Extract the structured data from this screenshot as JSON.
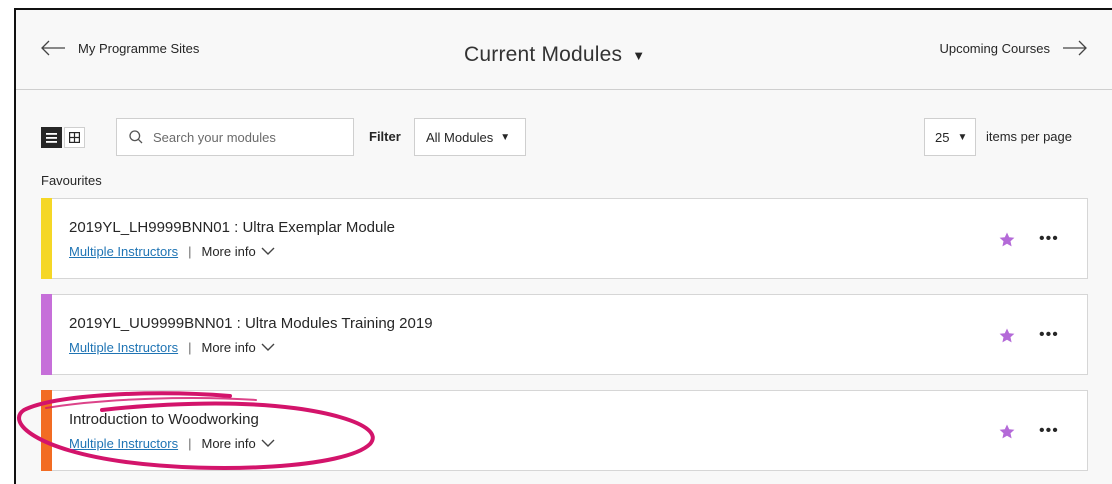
{
  "header": {
    "back_label": "My Programme Sites",
    "title": "Current Modules",
    "forward_label": "Upcoming Courses"
  },
  "toolbar": {
    "search_placeholder": "Search your modules",
    "filter_label": "Filter",
    "filter_value": "All Modules",
    "per_page_value": "25",
    "per_page_label": "items per page"
  },
  "favourites": {
    "heading": "Favourites",
    "items": [
      {
        "title": "2019YL_LH9999BNN01 : Ultra Exemplar Module",
        "instructors": "Multiple Instructors",
        "separator": "|",
        "more_info": "More info",
        "color": "#f5d726"
      },
      {
        "title": "2019YL_UU9999BNN01 : Ultra Modules Training 2019",
        "instructors": "Multiple Instructors",
        "separator": "|",
        "more_info": "More info",
        "color": "#c66fd9"
      },
      {
        "title": "Introduction to Woodworking",
        "instructors": "Multiple Instructors",
        "separator": "|",
        "more_info": "More info",
        "color": "#f26c23"
      }
    ]
  },
  "colors": {
    "star": "#b46ad8",
    "link": "#1f74b4",
    "annotation": "#d3146b"
  },
  "icons": {
    "back": "arrow-left-icon",
    "forward": "arrow-right-icon",
    "list_view": "list-view-icon",
    "grid_view": "grid-view-icon",
    "search": "search-icon",
    "favourite": "star-icon",
    "menu": "more-options-icon",
    "expand": "chevron-down-icon"
  }
}
